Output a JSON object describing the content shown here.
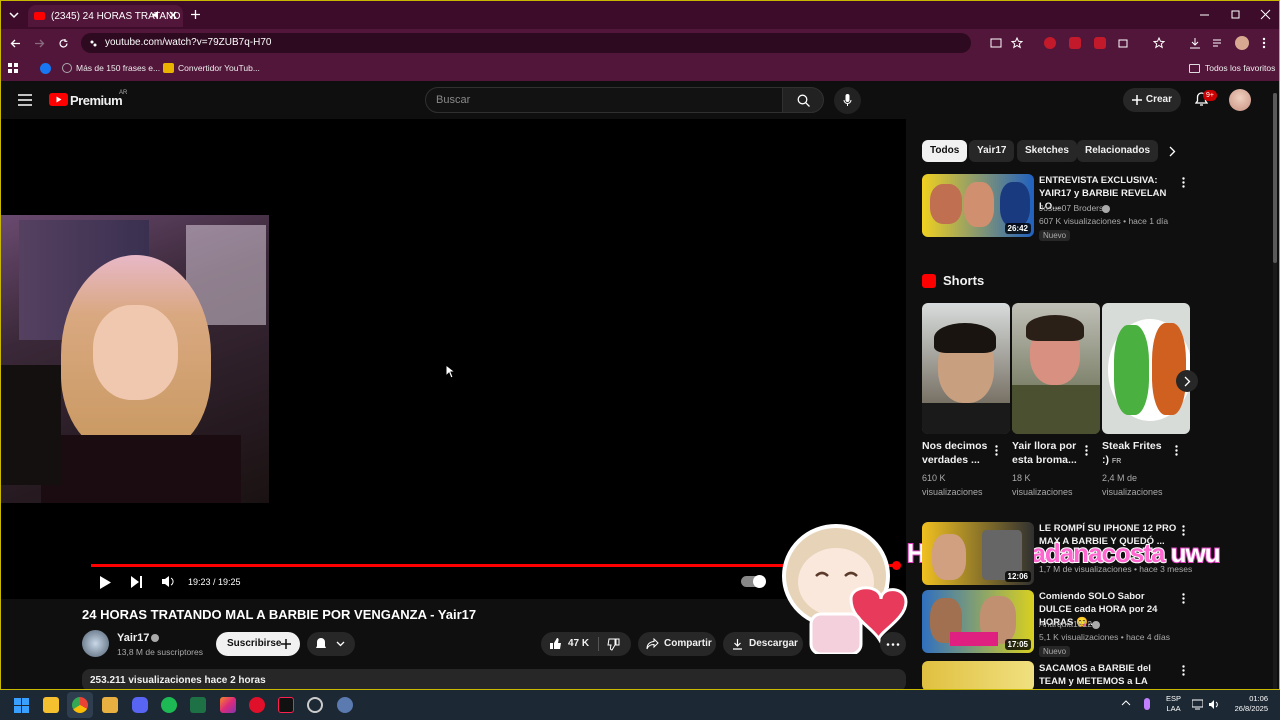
{
  "browser": {
    "tab_title": "(2345) 24 HORAS TRATAND",
    "url": "youtube.com/watch?v=79ZUB7q-H70",
    "bookmarks": [
      "Más de 150 frases e...",
      "Convertidor YouTub...",
      "Todos los favoritos"
    ]
  },
  "header": {
    "logo_text": "Premium",
    "country": "AR",
    "search_placeholder": "Buscar",
    "create_label": "Crear",
    "notif_count": "9+"
  },
  "player": {
    "time": "19:23 / 19:25",
    "progress": 0.998
  },
  "video": {
    "title": "24 HORAS TRATANDO MAL A BARBIE POR VENGANZA - Yair17",
    "channel": "Yair17",
    "subscribers": "13,8 M de suscriptores",
    "subscribe_label": "Suscribirse",
    "likes": "47 K",
    "share_label": "Compartir",
    "download_label": "Descargar",
    "views_line": "253.211 visualizaciones  hace 2 horas"
  },
  "chips": [
    "Todos",
    "Yair17",
    "Sketches",
    "Relacionados"
  ],
  "shorts_heading": "Shorts",
  "related": [
    {
      "title": "ENTREVISTA EXCLUSIVA: YAIR17 y BARBIE REVELAN LO...",
      "channel": "Josue07 Broders",
      "meta": "607 K visualizaciones • hace 1 día",
      "badge": "Nuevo",
      "duration": "26:42"
    },
    {
      "title": "LE ROMPÍ SU IPHONE 12 PRO MAX A BARBIE Y QUEDÓ ...",
      "channel": "",
      "meta": "1,7 M de visualizaciones • hace 3 meses",
      "badge": "",
      "duration": "12:06"
    },
    {
      "title": "Comiendo SOLO Sabor DULCE cada HORA por 24 HORAS 😋...",
      "channel": "Anarquia1812",
      "meta": "5,1 K visualizaciones • hace 4 días",
      "badge": "Nuevo",
      "duration": "17:05"
    },
    {
      "title": "SACAMOS a BARBIE del TEAM y METEMOS a LA CUBANA... ...",
      "channel": "",
      "meta": "",
      "badge": "",
      "duration": ""
    }
  ],
  "shorts": [
    {
      "title_line1": "Nos decimos",
      "title_line2": "verdades ...",
      "meta_line1": "610 K",
      "meta_line2": "visualizaciones"
    },
    {
      "title_line1": "Yair llora por",
      "title_line2": "esta broma...",
      "meta_line1": "18 K",
      "meta_line2": "visualizaciones"
    },
    {
      "title_line1": "Steak Frites",
      "title_line2": ":)",
      "title_badge": "FR",
      "meta_line1": "2,4 M de",
      "meta_line2": "visualizaciones"
    }
  ],
  "overlay_text": {
    "prefix": "Hola ",
    "name": "Jorgeadanacosta",
    "suffix": " uwu"
  },
  "taskbar": {
    "lang_top": "ESP",
    "lang_bottom": "LAA",
    "time": "01:06",
    "date": "26/8/2025"
  },
  "colors": {
    "accent": "#ff0000",
    "browser_frame": "#52163a",
    "background": "#0f0f0f"
  }
}
